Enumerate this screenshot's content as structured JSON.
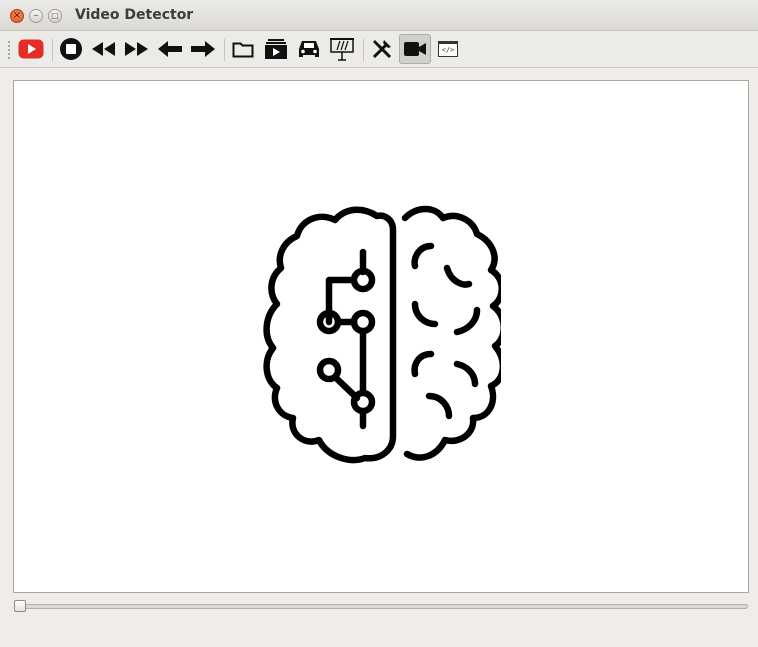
{
  "window": {
    "title": "Video Detector",
    "close_glyph": "×",
    "min_glyph": "–",
    "max_glyph": "□"
  },
  "toolbar": {
    "buttons": [
      {
        "name": "youtube-button",
        "icon": "youtube-icon"
      },
      {
        "name": "stop-button",
        "icon": "stop-icon"
      },
      {
        "name": "rewind-button",
        "icon": "rewind-icon"
      },
      {
        "name": "fast-forward-button",
        "icon": "fast-forward-icon"
      },
      {
        "name": "previous-button",
        "icon": "arrow-left-icon"
      },
      {
        "name": "next-button",
        "icon": "arrow-right-icon"
      },
      {
        "name": "open-folder-button",
        "icon": "folder-icon"
      },
      {
        "name": "open-video-button",
        "icon": "video-file-icon"
      },
      {
        "name": "car-detection-button",
        "icon": "car-icon"
      },
      {
        "name": "presentation-button",
        "icon": "presentation-board-icon"
      },
      {
        "name": "tools-button",
        "icon": "tools-icon"
      },
      {
        "name": "camera-button",
        "icon": "video-camera-icon",
        "active": true
      },
      {
        "name": "code-button",
        "icon": "code-icon",
        "label": "</>"
      }
    ]
  },
  "video_area": {
    "placeholder_icon": "brain-circuit-icon"
  },
  "seek_slider": {
    "value": 0
  },
  "colors": {
    "youtube_red": "#e52d27",
    "icon_black": "#111111",
    "window_bg": "#f0ede9",
    "close_orange": "#e0531f"
  }
}
